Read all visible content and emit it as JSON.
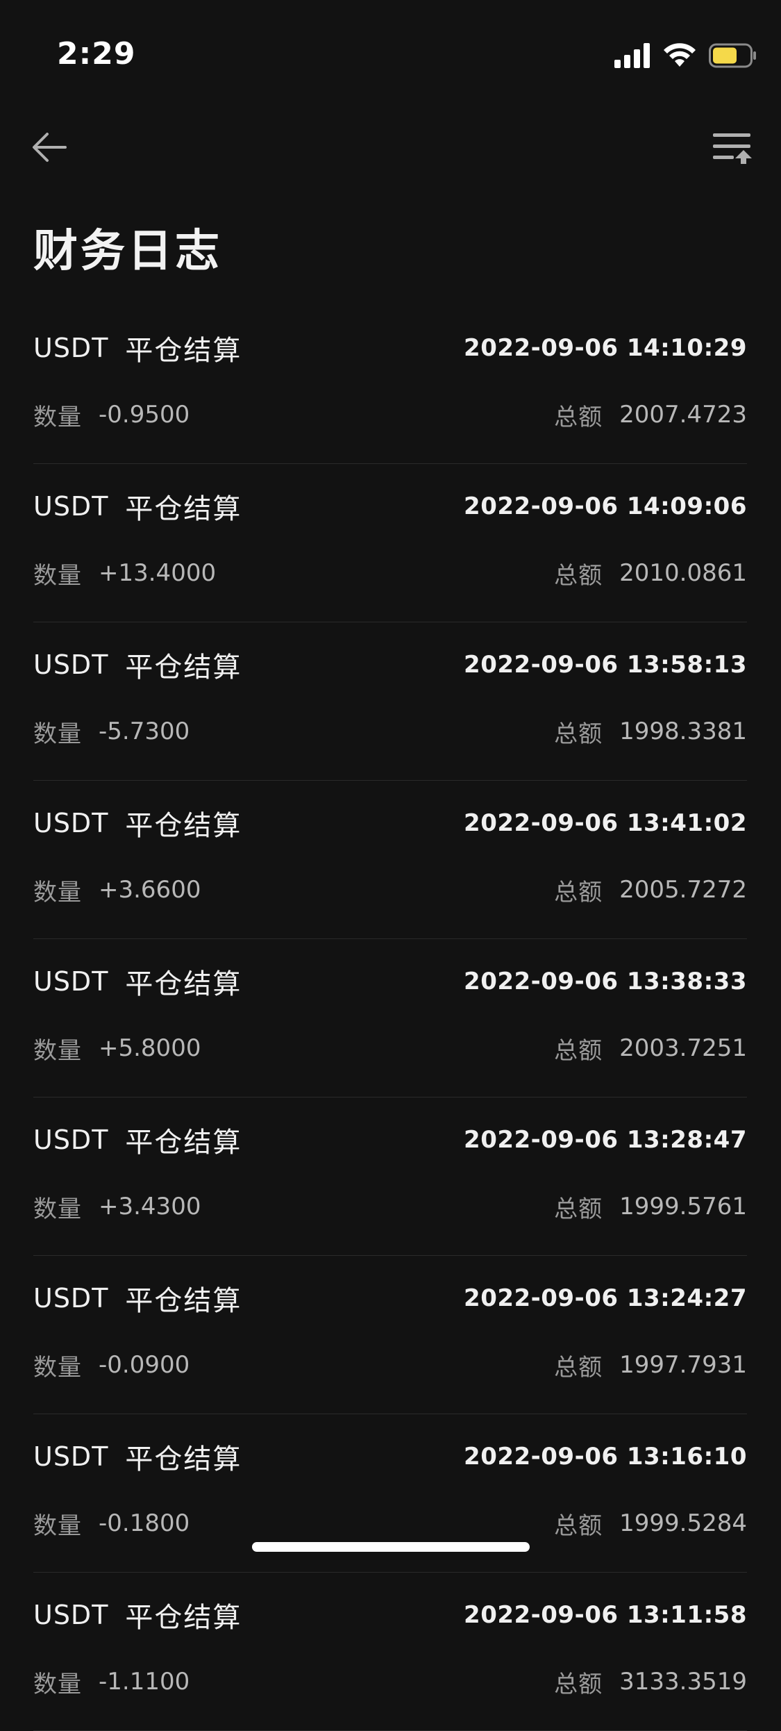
{
  "status_bar": {
    "time": "2:29",
    "battery_color": "#f5d94a"
  },
  "nav": {
    "back_icon": "arrow-left-icon",
    "sort_icon": "sort-upload-icon"
  },
  "page": {
    "title": "财务日志"
  },
  "labels": {
    "quantity": "数量",
    "total": "总额"
  },
  "entries": [
    {
      "asset": "USDT",
      "type": "平仓结算",
      "time": "2022-09-06 14:10:29",
      "quantity": "-0.9500",
      "total": "2007.4723"
    },
    {
      "asset": "USDT",
      "type": "平仓结算",
      "time": "2022-09-06 14:09:06",
      "quantity": "+13.4000",
      "total": "2010.0861"
    },
    {
      "asset": "USDT",
      "type": "平仓结算",
      "time": "2022-09-06 13:58:13",
      "quantity": "-5.7300",
      "total": "1998.3381"
    },
    {
      "asset": "USDT",
      "type": "平仓结算",
      "time": "2022-09-06 13:41:02",
      "quantity": "+3.6600",
      "total": "2005.7272"
    },
    {
      "asset": "USDT",
      "type": "平仓结算",
      "time": "2022-09-06 13:38:33",
      "quantity": "+5.8000",
      "total": "2003.7251"
    },
    {
      "asset": "USDT",
      "type": "平仓结算",
      "time": "2022-09-06 13:28:47",
      "quantity": "+3.4300",
      "total": "1999.5761"
    },
    {
      "asset": "USDT",
      "type": "平仓结算",
      "time": "2022-09-06 13:24:27",
      "quantity": "-0.0900",
      "total": "1997.7931"
    },
    {
      "asset": "USDT",
      "type": "平仓结算",
      "time": "2022-09-06 13:16:10",
      "quantity": "-0.1800",
      "total": "1999.5284"
    },
    {
      "asset": "USDT",
      "type": "平仓结算",
      "time": "2022-09-06 13:11:58",
      "quantity": "-1.1100",
      "total": "3133.3519"
    }
  ]
}
